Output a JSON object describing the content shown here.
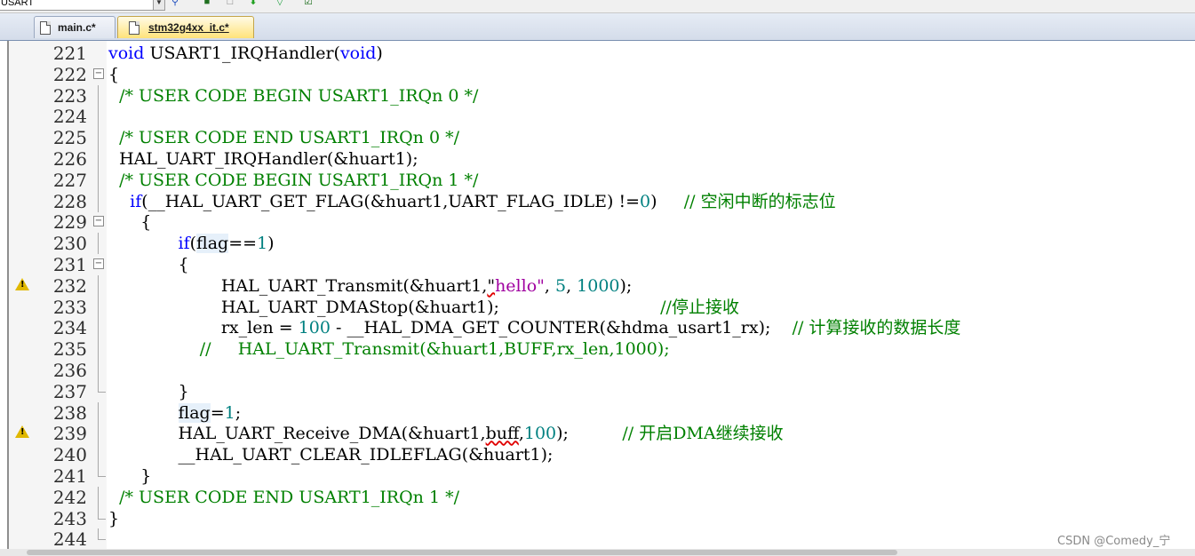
{
  "toolbar": {
    "combo_value": "USART"
  },
  "tabs": [
    {
      "label": "main.c*",
      "active": false
    },
    {
      "label": "stm32g4xx_it.c*",
      "active": true
    }
  ],
  "editor": {
    "lines": [
      {
        "num": "221",
        "fold": "",
        "warn": false,
        "parts": [
          [
            "kw",
            "void"
          ],
          [
            "t",
            " USART1_IRQHandler("
          ],
          [
            "kw",
            "void"
          ],
          [
            "t",
            ")"
          ]
        ]
      },
      {
        "num": "222",
        "fold": "box",
        "warn": false,
        "parts": [
          [
            "t",
            "{"
          ]
        ]
      },
      {
        "num": "223",
        "fold": "line",
        "warn": false,
        "parts": [
          [
            "t",
            "  "
          ],
          [
            "cm",
            "/* USER CODE BEGIN USART1_IRQn 0 */"
          ]
        ]
      },
      {
        "num": "224",
        "fold": "line",
        "warn": false,
        "parts": []
      },
      {
        "num": "225",
        "fold": "line",
        "warn": false,
        "parts": [
          [
            "t",
            "  "
          ],
          [
            "cm",
            "/* USER CODE END USART1_IRQn 0 */"
          ]
        ]
      },
      {
        "num": "226",
        "fold": "line",
        "warn": false,
        "parts": [
          [
            "t",
            "  HAL_UART_IRQHandler(&huart1);"
          ]
        ]
      },
      {
        "num": "227",
        "fold": "line",
        "warn": false,
        "parts": [
          [
            "t",
            "  "
          ],
          [
            "cm",
            "/* USER CODE BEGIN USART1_IRQn 1 */"
          ]
        ]
      },
      {
        "num": "228",
        "fold": "line",
        "warn": false,
        "parts": [
          [
            "t",
            "    "
          ],
          [
            "kw",
            "if"
          ],
          [
            "t",
            "(__HAL_UART_GET_FLAG(&huart1,UART_FLAG_IDLE) !="
          ],
          [
            "num",
            "0"
          ],
          [
            "t",
            ")     "
          ],
          [
            "cm",
            "// 空闲中断的标志位"
          ]
        ]
      },
      {
        "num": "229",
        "fold": "box",
        "warn": false,
        "parts": [
          [
            "t",
            "      {"
          ]
        ]
      },
      {
        "num": "230",
        "fold": "line",
        "warn": false,
        "parts": [
          [
            "t",
            "             "
          ],
          [
            "kw",
            "if"
          ],
          [
            "t",
            "("
          ],
          [
            "hl",
            "flag"
          ],
          [
            "t",
            "=="
          ],
          [
            "num",
            "1"
          ],
          [
            "t",
            ")"
          ]
        ]
      },
      {
        "num": "231",
        "fold": "box",
        "warn": false,
        "parts": [
          [
            "t",
            "             {"
          ]
        ]
      },
      {
        "num": "232",
        "fold": "line",
        "warn": true,
        "parts": [
          [
            "t",
            "                     HAL_UART_Transmit(&huart1,"
          ],
          [
            "sq",
            "\""
          ],
          [
            "str",
            "hello\""
          ],
          [
            "t",
            ", "
          ],
          [
            "num",
            "5"
          ],
          [
            "t",
            ", "
          ],
          [
            "num",
            "1000"
          ],
          [
            "t",
            ");"
          ]
        ]
      },
      {
        "num": "233",
        "fold": "line",
        "warn": false,
        "parts": [
          [
            "t",
            "                     HAL_UART_DMAStop(&huart1);                              "
          ],
          [
            "cm",
            "//停止接收"
          ]
        ]
      },
      {
        "num": "234",
        "fold": "line",
        "warn": false,
        "parts": [
          [
            "t",
            "                     rx_len = "
          ],
          [
            "num",
            "100"
          ],
          [
            "t",
            " - __HAL_DMA_GET_COUNTER(&hdma_usart1_rx);    "
          ],
          [
            "cm",
            "// 计算接收的数据长度"
          ]
        ]
      },
      {
        "num": "235",
        "fold": "line",
        "warn": false,
        "parts": [
          [
            "t",
            "                 "
          ],
          [
            "cm",
            "//     HAL_UART_Transmit(&huart1,BUFF,rx_len,1000);"
          ]
        ]
      },
      {
        "num": "236",
        "fold": "line",
        "warn": false,
        "parts": []
      },
      {
        "num": "237",
        "fold": "end",
        "warn": false,
        "parts": [
          [
            "t",
            "             }"
          ]
        ]
      },
      {
        "num": "238",
        "fold": "line",
        "warn": false,
        "parts": [
          [
            "t",
            "             "
          ],
          [
            "hl",
            "flag"
          ],
          [
            "t",
            "="
          ],
          [
            "num",
            "1"
          ],
          [
            "t",
            ";"
          ]
        ]
      },
      {
        "num": "239",
        "fold": "line",
        "warn": true,
        "parts": [
          [
            "t",
            "             HAL_UART_Receive_DMA(&huart1,"
          ],
          [
            "sq",
            "buff"
          ],
          [
            "t",
            ","
          ],
          [
            "num",
            "100"
          ],
          [
            "t",
            ");          "
          ],
          [
            "cm",
            "// 开启DMA继续接收"
          ]
        ]
      },
      {
        "num": "240",
        "fold": "line",
        "warn": false,
        "parts": [
          [
            "t",
            "             __HAL_UART_CLEAR_IDLEFLAG(&huart1);"
          ]
        ]
      },
      {
        "num": "241",
        "fold": "end",
        "warn": false,
        "parts": [
          [
            "t",
            "      }"
          ]
        ]
      },
      {
        "num": "242",
        "fold": "line",
        "warn": false,
        "parts": [
          [
            "t",
            "  "
          ],
          [
            "cm",
            "/* USER CODE END USART1_IRQn 1 */"
          ]
        ]
      },
      {
        "num": "243",
        "fold": "end",
        "warn": false,
        "parts": [
          [
            "t",
            "}"
          ]
        ]
      },
      {
        "num": "244",
        "fold": "end",
        "warn": false,
        "parts": []
      }
    ]
  },
  "watermark": "CSDN @Comedy_宁"
}
